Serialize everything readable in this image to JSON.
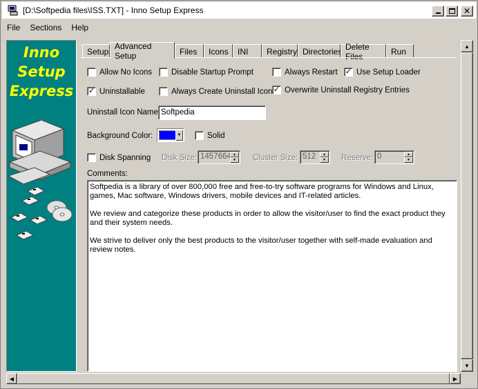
{
  "window": {
    "title": "[D:\\Softpedia files\\ISS.TXT] - Inno Setup Express",
    "controls": {
      "minimize": "_",
      "maximize": "□",
      "close": "✕"
    }
  },
  "menu": [
    "File",
    "Sections",
    "Help"
  ],
  "banner": {
    "line1": "Inno",
    "line2": "Setup",
    "line3": "Express",
    "bg_color": "#008080",
    "text_color": "#ffff00"
  },
  "tabs": [
    "Setup",
    "Advanced Setup",
    "Files",
    "Icons",
    "INI",
    "Registry",
    "Directories",
    "Delete Files",
    "Run"
  ],
  "active_tab": "Advanced Setup",
  "options": {
    "allow_no_icons": {
      "label": "Allow No Icons",
      "checked": false
    },
    "disable_startup_prompt": {
      "label": "Disable Startup Prompt",
      "checked": false
    },
    "always_restart": {
      "label": "Always Restart",
      "checked": false
    },
    "use_setup_loader": {
      "label": "Use Setup Loader",
      "checked": true
    },
    "uninstallable": {
      "label": "Uninstallable",
      "checked": true
    },
    "always_create_uninstall_icon": {
      "label": "Always Create Uninstall Icon",
      "checked": false
    },
    "overwrite_uninstall_registry": {
      "label": "Overwrite Uninstall Registry Entries",
      "checked": true
    },
    "solid": {
      "label": "Solid",
      "checked": false
    },
    "disk_spanning": {
      "label": "Disk Spanning",
      "checked": false
    }
  },
  "uninstall_icon_name": {
    "label": "Uninstall Icon Name:",
    "value": "Softpedia"
  },
  "background_color": {
    "label": "Background Color:",
    "value_color": "#0000ff"
  },
  "disk": {
    "disk_size_label": "Disk Size:",
    "disk_size_value": "1457664",
    "cluster_size_label": "Cluster Size:",
    "cluster_size_value": "512",
    "reserve_label": "Reserve:",
    "reserve_value": "0"
  },
  "comments": {
    "label": "Comments:",
    "paragraphs": [
      "Softpedia is a library of over 800,000 free and free-to-try software programs for Windows and Linux, games, Mac software, Windows drivers, mobile devices and IT-related articles.",
      "We review and categorize these products in order to allow the visitor/user to find the exact product they and their system needs.",
      "We strive to deliver only the best products to the visitor/user together with self-made evaluation and review notes."
    ]
  }
}
